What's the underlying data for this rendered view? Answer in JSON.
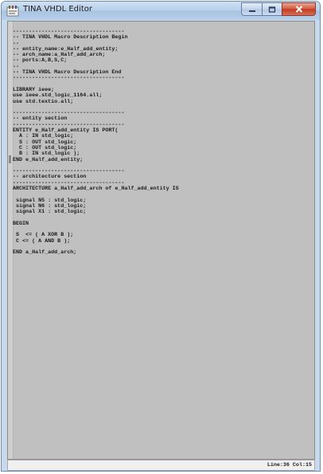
{
  "window": {
    "title": "TINA VHDL Editor"
  },
  "colors": {
    "editor_background": "#c0c0c0",
    "code_text": "#1a1a1a",
    "close_button": "#c2391c"
  },
  "icons": [
    "tina-app-icon",
    "minimize-icon",
    "maximize-icon",
    "close-icon"
  ],
  "editor": {
    "lines": [
      "-----------------------------------",
      "-- TINA VHDL Macro Description Begin",
      "--",
      "-- entity_name:e_Half_add_entity;",
      "-- arch_name:a_Half_add_arch;",
      "-- ports:A,B,S,C;",
      "--",
      "-- TINA VHDL Macro Description End",
      "-----------------------------------",
      "",
      "LIBRARY ieee;",
      "use ieee.std_logic_1164.all;",
      "use std.textio.all;",
      "",
      "-----------------------------------",
      "-- entity section",
      "-----------------------------------",
      "ENTITY e_Half_add_entity IS PORT(",
      "  A : IN std_logic;",
      "  S : OUT std_logic;",
      "  C : OUT std_logic;",
      "  B : IN std_logic );",
      "END e_Half_add_entity;",
      "",
      "-----------------------------------",
      "-- architecture section",
      "-----------------------------------",
      "ARCHITECTURE a_Half_add_arch of e_Half_add_entity IS",
      "",
      " signal N5 : std_logic;",
      " signal N6 : std_logic;",
      " signal X1 : std_logic;",
      "",
      "BEGIN",
      "",
      " S  <= ( A XOR B );",
      " C <= ( A AND B );",
      "",
      "END a_Half_add_arch;"
    ]
  },
  "status": {
    "position": "Line:36 Col:15"
  }
}
